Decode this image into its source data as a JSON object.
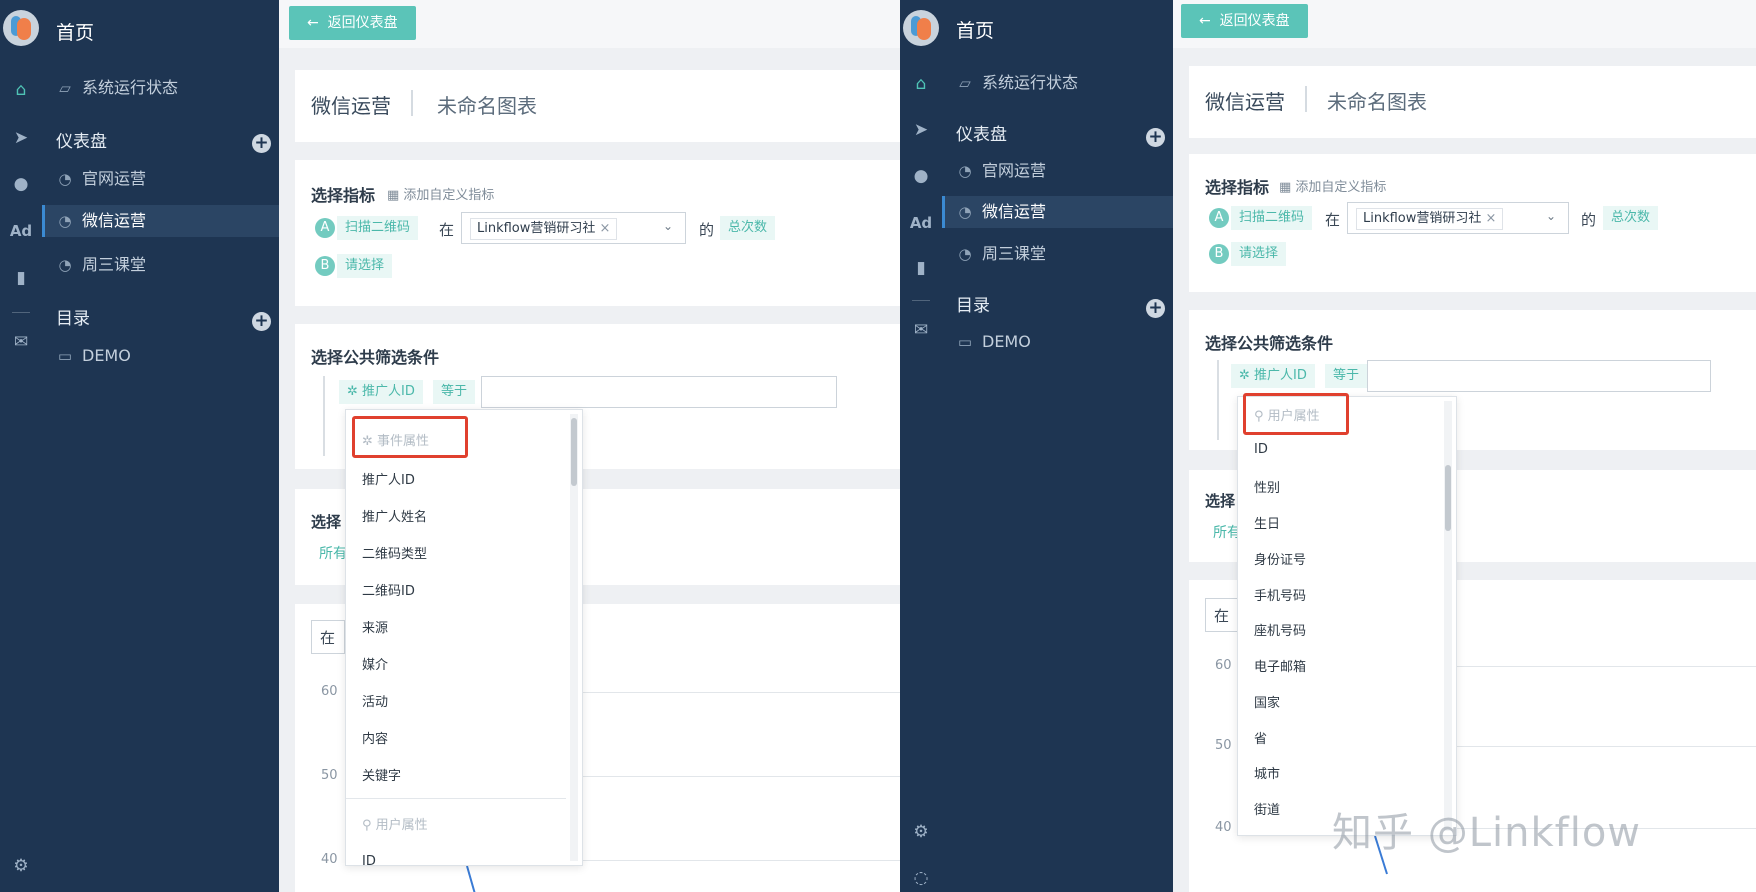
{
  "nav": {
    "home_label": "首页",
    "system_status": "系统运行状态",
    "dashboards_label": "仪表盘",
    "dashboards": [
      "官网运营",
      "微信运营",
      "周三课堂"
    ],
    "catalog_label": "目录",
    "folder": "DEMO",
    "iconbar_ad": "Ad"
  },
  "toolbar": {
    "back_label": "返回仪表盘"
  },
  "report": {
    "dashboard_name": "微信运营",
    "chart_name": "未命名图表"
  },
  "metrics": {
    "heading": "选择指标",
    "add_custom": "添加自定义指标",
    "row_a_badge": "A",
    "row_a_event": "扫描二维码",
    "in_word": "在",
    "tag_value": "Linkflow营销研习社",
    "of_word": "的",
    "measure": "总次数",
    "row_b_badge": "B",
    "row_b_placeholder": "请选择"
  },
  "filter": {
    "heading": "选择公共筛选条件",
    "field": "推广人ID",
    "operator": "等于",
    "input_value": ""
  },
  "partial": {
    "left_section": "选择",
    "left_chip": "所有",
    "left_select": "在",
    "right_section": "选择",
    "right_chip": "所有",
    "right_select": "在"
  },
  "chart_axis": {
    "y_ticks": [
      "60",
      "50",
      "40"
    ]
  },
  "dropdown_left": {
    "group_event": "事件属性",
    "items": [
      "推广人ID",
      "推广人姓名",
      "二维码类型",
      "二维码ID",
      "来源",
      "媒介",
      "活动",
      "内容",
      "关键字"
    ],
    "group_user": "用户属性",
    "trailing": "ID"
  },
  "dropdown_right": {
    "group_user": "用户属性",
    "items": [
      "ID",
      "性别",
      "生日",
      "身份证号",
      "手机号码",
      "座机号码",
      "电子邮箱",
      "国家",
      "省",
      "城市",
      "街道"
    ]
  },
  "watermark": "知乎 @Linkflow",
  "colors": {
    "sidebar": "#1e3552",
    "accent": "#5bc4b8",
    "highlight": "#e0402e"
  }
}
